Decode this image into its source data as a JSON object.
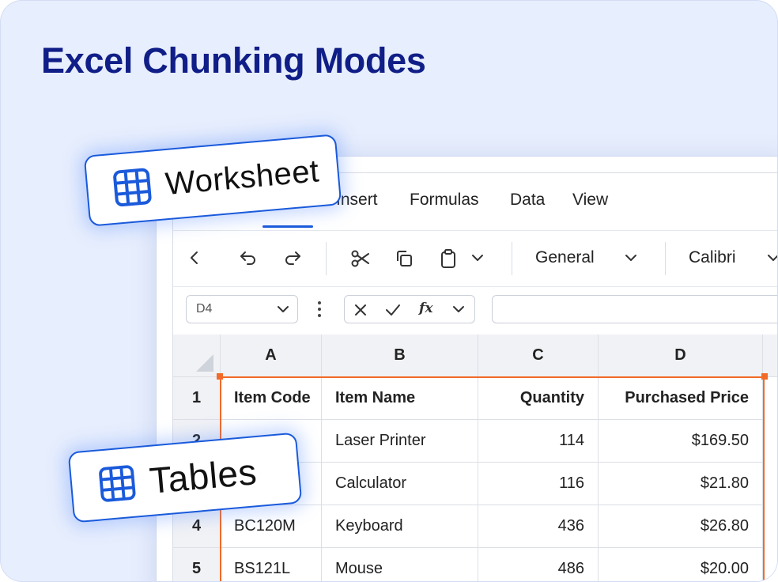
{
  "page": {
    "title": "Excel Chunking Modes"
  },
  "menu": {
    "items": [
      "Insert",
      "Formulas",
      "Data",
      "View"
    ]
  },
  "toolbar": {
    "number_format": "General",
    "font_name": "Calibri",
    "icons": [
      "chevron-left-icon",
      "undo-icon",
      "redo-icon",
      "scissors-icon",
      "copy-icon",
      "paste-icon",
      "chevron-down-icon"
    ]
  },
  "formula_bar": {
    "name_box": "D4",
    "fx_label": "fx",
    "value": ""
  },
  "sheet": {
    "columns": [
      "A",
      "B",
      "C",
      "D"
    ],
    "row_numbers": [
      "1",
      "2",
      "3",
      "4",
      "5"
    ],
    "header_row": [
      "Item Code",
      "Item Name",
      "Quantity",
      "Purchased Price"
    ],
    "rows": [
      [
        "",
        "Laser Printer",
        "114",
        "$169.50"
      ],
      [
        "",
        "Calculator",
        "116",
        "$21.80"
      ],
      [
        "BC120M",
        "Keyboard",
        "436",
        "$26.80"
      ],
      [
        "BS121L",
        "Mouse",
        "486",
        "$20.00"
      ]
    ]
  },
  "badges": {
    "worksheet": "Worksheet",
    "tables": "Tables"
  },
  "colors": {
    "accent": "#1a5adb",
    "selection": "#f26a28",
    "title": "#101e87",
    "background": "#e7eefd"
  }
}
